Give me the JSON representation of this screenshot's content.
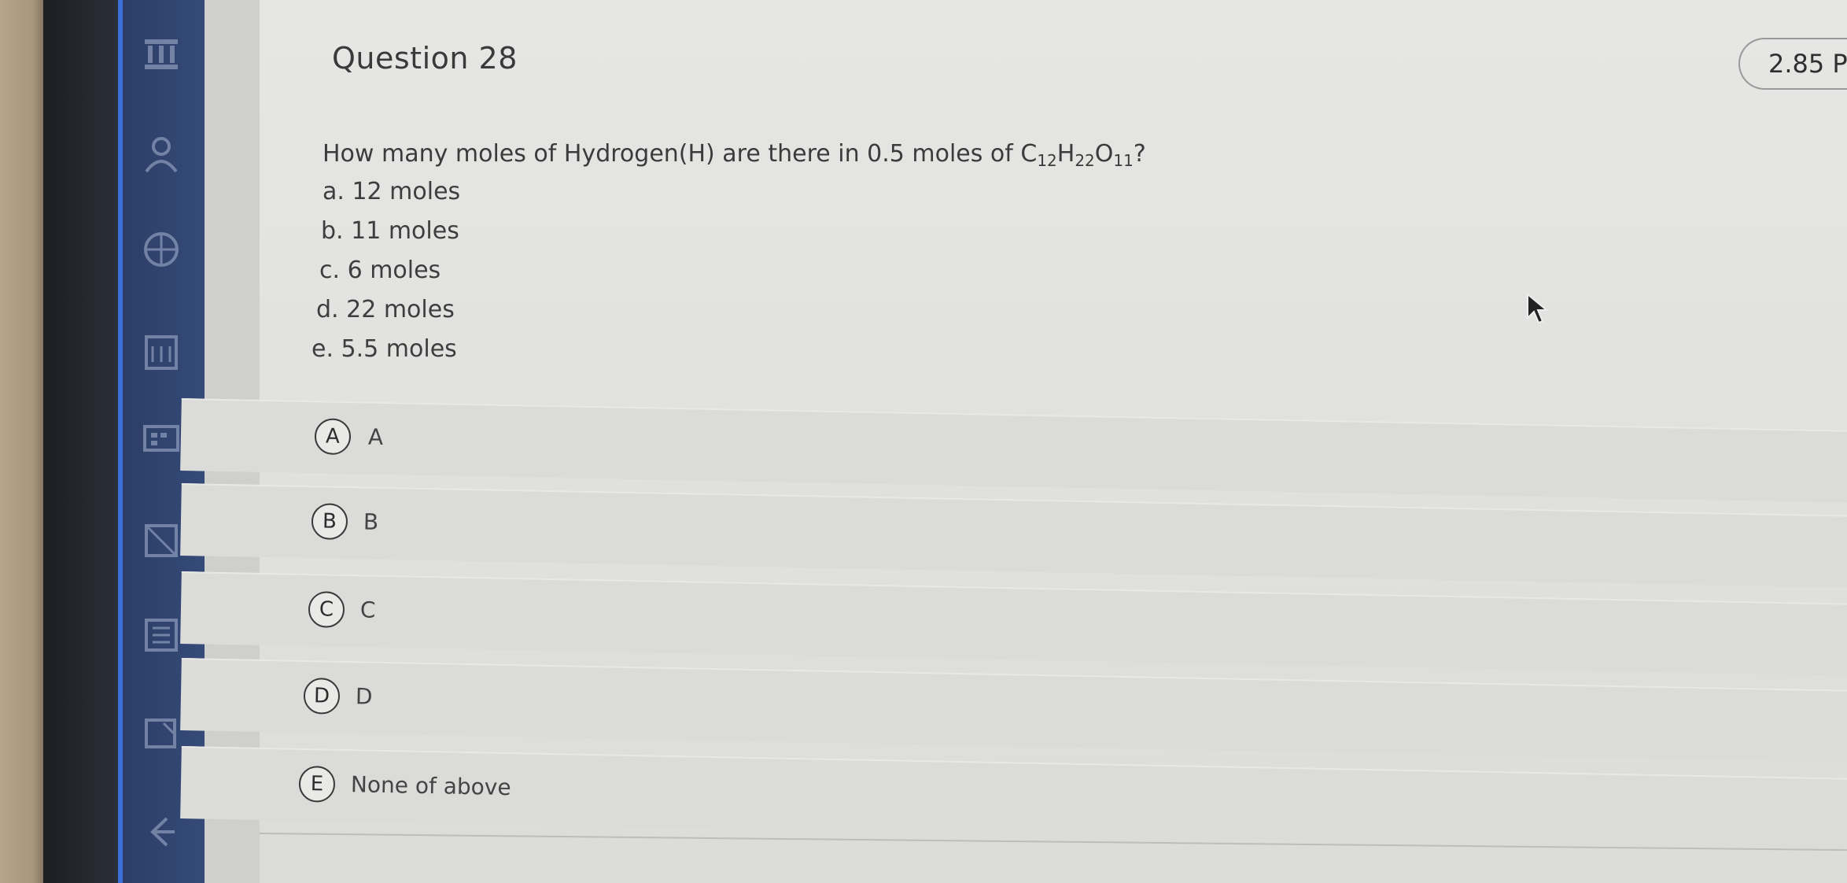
{
  "question": {
    "title": "Question 28",
    "points": "2.85 P",
    "prompt_text": "How many moles of Hydrogen(H) are there in 0.5 moles of C",
    "formula": {
      "c_sub": "12",
      "h": "H",
      "h_sub": "22",
      "o": "O",
      "o_sub": "11",
      "end": "?"
    },
    "options": [
      {
        "text": "a. 12 moles"
      },
      {
        "text": "b. 11 moles"
      },
      {
        "text": "c. 6 moles"
      },
      {
        "text": "d. 22 moles"
      },
      {
        "text": "e. 5.5 moles"
      }
    ]
  },
  "choices": [
    {
      "letter": "A",
      "label": "A"
    },
    {
      "letter": "B",
      "label": "B"
    },
    {
      "letter": "C",
      "label": "C"
    },
    {
      "letter": "D",
      "label": "D"
    },
    {
      "letter": "E",
      "label": "None of above"
    }
  ],
  "sidebar": {
    "icons": [
      "institution-icon",
      "account-icon",
      "courses-icon",
      "calendar-icon",
      "inbox-icon",
      "history-icon",
      "commons-icon",
      "help-icon"
    ]
  },
  "colors": {
    "sidebar": "#2c3e66",
    "sidebar_accent": "#3a6ed8",
    "background": "#e4e4e2"
  }
}
